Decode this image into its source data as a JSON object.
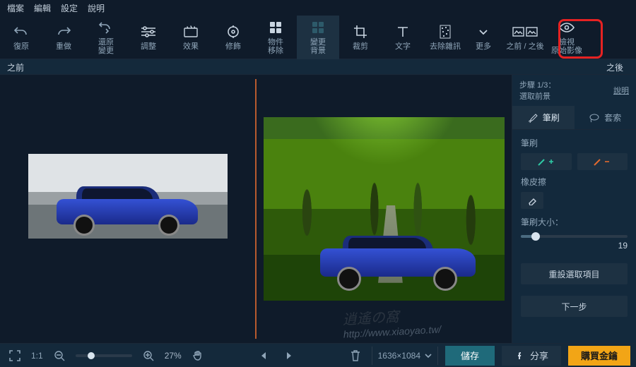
{
  "menu": {
    "file": "檔案",
    "edit": "編輯",
    "settings": "設定",
    "help": "說明"
  },
  "toolbar": {
    "undo": "復原",
    "redo": "重做",
    "revert": "還原\n變更",
    "adjust": "調整",
    "effects": "效果",
    "retouch": "修飾",
    "object_remove": "物件\n移除",
    "change_bg": "變更\n背景",
    "crop": "裁剪",
    "text": "文字",
    "denoise": "去除雜訊",
    "more": "更多",
    "before_after": "之前 / 之後",
    "view_original": "檢視\n原始影像"
  },
  "labels": {
    "before": "之前",
    "after": "之後"
  },
  "panel": {
    "step": "步驟 1/3：",
    "step_desc": "選取前景",
    "help": "說明",
    "tab_brush": "筆刷",
    "tab_lasso": "套索",
    "brush": "筆刷",
    "eraser": "橡皮擦",
    "brush_size": "筆刷大小：",
    "brush_value": "19",
    "reset": "重設選取項目",
    "next": "下一步"
  },
  "status": {
    "ratio": "1:1",
    "zoom": "27%",
    "dimensions": "1636×1084",
    "save": "儲存",
    "share": "分享",
    "buy": "購買金鑰"
  },
  "watermark": {
    "title": "逍遙の窩",
    "url": "http://www.xiaoyao.tw/"
  }
}
